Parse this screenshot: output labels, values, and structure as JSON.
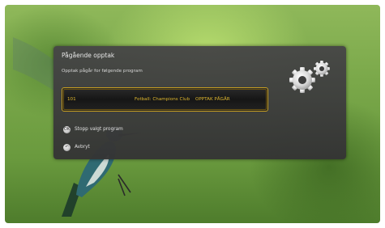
{
  "dialog": {
    "title": "Pågående opptak",
    "subtitle": "Opptak pågår for følgende program"
  },
  "program": {
    "channel_number": "101",
    "name": "Fotball: Champions Club",
    "status": "OPPTAK PÅGÅR"
  },
  "options": [
    {
      "label": "Stopp valgt program",
      "icon": "ok-button-icon",
      "glyph": "OK"
    },
    {
      "label": "Avbryt",
      "icon": "back-button-icon",
      "glyph": "↶"
    }
  ],
  "colors": {
    "accent": "#e0b830",
    "dialog_bg": "#3a3a3a",
    "text": "#e2e2e2"
  }
}
